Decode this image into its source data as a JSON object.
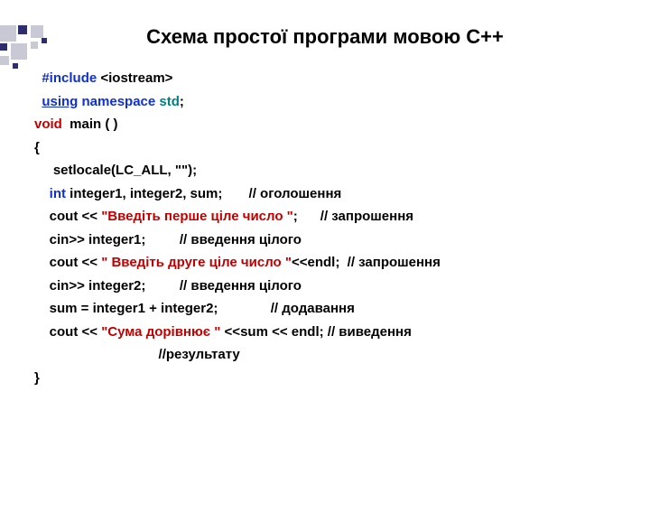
{
  "title": "Схема простої програми мовою С++",
  "lines": {
    "l1_include": "#include",
    "l1_rest": " <iostream>",
    "l2_using": "using",
    "l2_namespace": " namespace",
    "l2_std": " std",
    "l2_semi": ";",
    "l3_void": "void",
    "l3_main": "  main ( )",
    "l4": "{",
    "l5": "     setlocale(LC_ALL, \"\");",
    "l6_int": "    int",
    "l6_rest": " integer1, integer2, sum;       // оголошення",
    "l7_a": "    cout ",
    "l7_op1": "<<",
    "l7_str": " \"Введіть перше ціле число \"",
    "l7_b": ";      // запрошення",
    "l8": "    cin>> integer1;         // введення цілого",
    "l9_a": "    cout ",
    "l9_op1": "<<",
    "l9_str": " \" Введіть друге ціле число \"",
    "l9_op2": "<<",
    "l9_b": "endl;  // запрошення",
    "l10": "    cin>> integer2;         // введення цілого",
    "l11": "    sum = integer1 + integer2;              // додавання",
    "l12_a": "    cout ",
    "l12_op1": "<<",
    "l12_str": " \"Сума дорівнює \" ",
    "l12_op2": "<<",
    "l12_b": "sum ",
    "l12_op3": "<<",
    "l12_c": " endl; // виведення",
    "l13": "                                 //результату",
    "l14": "}"
  }
}
